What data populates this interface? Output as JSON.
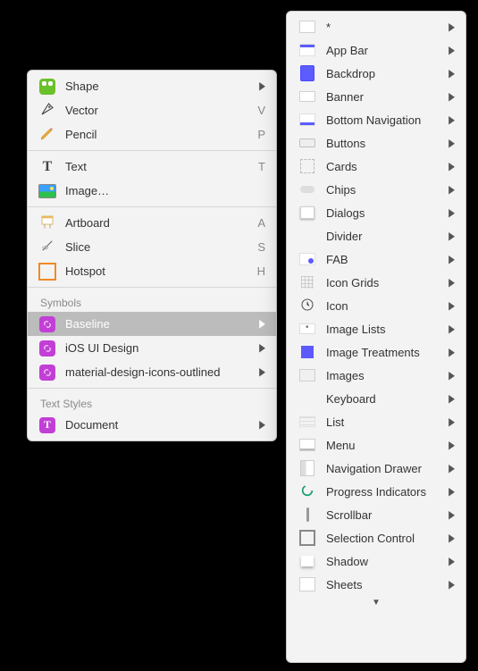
{
  "primary": {
    "groups": [
      {
        "items": [
          {
            "icon": "shape",
            "label": "Shape",
            "arrow": true
          },
          {
            "icon": "vector",
            "label": "Vector",
            "shortcut": "V"
          },
          {
            "icon": "pencil",
            "label": "Pencil",
            "shortcut": "P"
          }
        ]
      },
      {
        "items": [
          {
            "icon": "text",
            "label": "Text",
            "shortcut": "T"
          },
          {
            "icon": "image",
            "label": "Image…"
          }
        ]
      },
      {
        "items": [
          {
            "icon": "artboard",
            "label": "Artboard",
            "shortcut": "A"
          },
          {
            "icon": "slice",
            "label": "Slice",
            "shortcut": "S"
          },
          {
            "icon": "hotspot",
            "label": "Hotspot",
            "shortcut": "H"
          }
        ]
      },
      {
        "header": "Symbols",
        "items": [
          {
            "icon": "symbol",
            "label": "Baseline",
            "arrow": true,
            "selected": true
          },
          {
            "icon": "symbol",
            "label": "iOS UI Design",
            "arrow": true
          },
          {
            "icon": "symbol",
            "label": "material-design-icons-outlined",
            "arrow": true
          }
        ]
      },
      {
        "header": "Text Styles",
        "items": [
          {
            "icon": "doc",
            "label": "Document",
            "arrow": true
          }
        ]
      }
    ]
  },
  "secondary": {
    "items": [
      {
        "thumb": "blank",
        "label": "*"
      },
      {
        "thumb": "appbar",
        "label": "App Bar"
      },
      {
        "thumb": "backdrop",
        "label": "Backdrop"
      },
      {
        "thumb": "banner",
        "label": "Banner"
      },
      {
        "thumb": "bottomnav",
        "label": "Bottom Navigation"
      },
      {
        "thumb": "button",
        "label": "Buttons"
      },
      {
        "thumb": "card",
        "label": "Cards"
      },
      {
        "thumb": "chip",
        "label": "Chips"
      },
      {
        "thumb": "dialog",
        "label": "Dialogs"
      },
      {
        "thumb": "",
        "label": "Divider"
      },
      {
        "thumb": "fab",
        "label": "FAB"
      },
      {
        "thumb": "grid",
        "label": "Icon Grids"
      },
      {
        "thumb": "icon",
        "label": "Icon"
      },
      {
        "thumb": "imglist",
        "label": "Image Lists"
      },
      {
        "thumb": "imgtr",
        "label": "Image Treatments"
      },
      {
        "thumb": "images",
        "label": "Images"
      },
      {
        "thumb": "",
        "label": "Keyboard"
      },
      {
        "thumb": "list",
        "label": "List"
      },
      {
        "thumb": "menu",
        "label": "Menu"
      },
      {
        "thumb": "navdrawer",
        "label": "Navigation Drawer"
      },
      {
        "thumb": "progress",
        "label": "Progress Indicators"
      },
      {
        "thumb": "scroll",
        "label": "Scrollbar"
      },
      {
        "thumb": "selctl",
        "label": "Selection Control"
      },
      {
        "thumb": "shadow",
        "label": "Shadow"
      },
      {
        "thumb": "sheet",
        "label": "Sheets"
      }
    ]
  }
}
